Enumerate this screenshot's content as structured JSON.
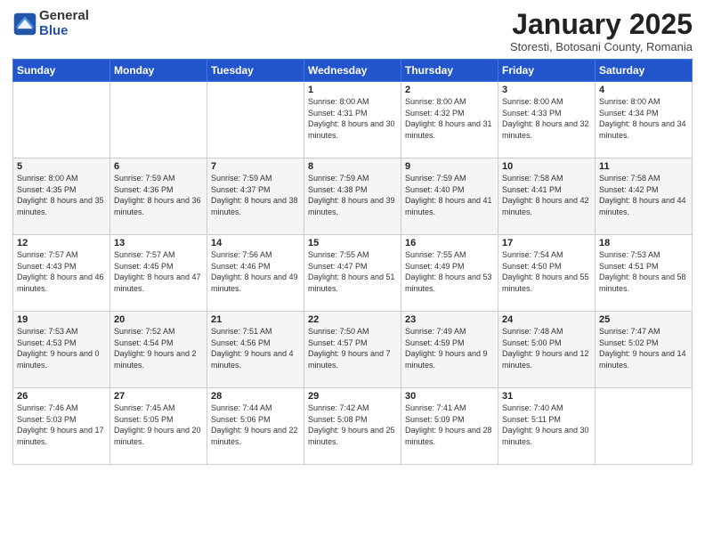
{
  "logo": {
    "general": "General",
    "blue": "Blue"
  },
  "header": {
    "month": "January 2025",
    "location": "Storesti, Botosani County, Romania"
  },
  "weekdays": [
    "Sunday",
    "Monday",
    "Tuesday",
    "Wednesday",
    "Thursday",
    "Friday",
    "Saturday"
  ],
  "weeks": [
    [
      {
        "day": "",
        "info": ""
      },
      {
        "day": "",
        "info": ""
      },
      {
        "day": "",
        "info": ""
      },
      {
        "day": "1",
        "info": "Sunrise: 8:00 AM\nSunset: 4:31 PM\nDaylight: 8 hours\nand 30 minutes."
      },
      {
        "day": "2",
        "info": "Sunrise: 8:00 AM\nSunset: 4:32 PM\nDaylight: 8 hours\nand 31 minutes."
      },
      {
        "day": "3",
        "info": "Sunrise: 8:00 AM\nSunset: 4:33 PM\nDaylight: 8 hours\nand 32 minutes."
      },
      {
        "day": "4",
        "info": "Sunrise: 8:00 AM\nSunset: 4:34 PM\nDaylight: 8 hours\nand 34 minutes."
      }
    ],
    [
      {
        "day": "5",
        "info": "Sunrise: 8:00 AM\nSunset: 4:35 PM\nDaylight: 8 hours\nand 35 minutes."
      },
      {
        "day": "6",
        "info": "Sunrise: 7:59 AM\nSunset: 4:36 PM\nDaylight: 8 hours\nand 36 minutes."
      },
      {
        "day": "7",
        "info": "Sunrise: 7:59 AM\nSunset: 4:37 PM\nDaylight: 8 hours\nand 38 minutes."
      },
      {
        "day": "8",
        "info": "Sunrise: 7:59 AM\nSunset: 4:38 PM\nDaylight: 8 hours\nand 39 minutes."
      },
      {
        "day": "9",
        "info": "Sunrise: 7:59 AM\nSunset: 4:40 PM\nDaylight: 8 hours\nand 41 minutes."
      },
      {
        "day": "10",
        "info": "Sunrise: 7:58 AM\nSunset: 4:41 PM\nDaylight: 8 hours\nand 42 minutes."
      },
      {
        "day": "11",
        "info": "Sunrise: 7:58 AM\nSunset: 4:42 PM\nDaylight: 8 hours\nand 44 minutes."
      }
    ],
    [
      {
        "day": "12",
        "info": "Sunrise: 7:57 AM\nSunset: 4:43 PM\nDaylight: 8 hours\nand 46 minutes."
      },
      {
        "day": "13",
        "info": "Sunrise: 7:57 AM\nSunset: 4:45 PM\nDaylight: 8 hours\nand 47 minutes."
      },
      {
        "day": "14",
        "info": "Sunrise: 7:56 AM\nSunset: 4:46 PM\nDaylight: 8 hours\nand 49 minutes."
      },
      {
        "day": "15",
        "info": "Sunrise: 7:55 AM\nSunset: 4:47 PM\nDaylight: 8 hours\nand 51 minutes."
      },
      {
        "day": "16",
        "info": "Sunrise: 7:55 AM\nSunset: 4:49 PM\nDaylight: 8 hours\nand 53 minutes."
      },
      {
        "day": "17",
        "info": "Sunrise: 7:54 AM\nSunset: 4:50 PM\nDaylight: 8 hours\nand 55 minutes."
      },
      {
        "day": "18",
        "info": "Sunrise: 7:53 AM\nSunset: 4:51 PM\nDaylight: 8 hours\nand 58 minutes."
      }
    ],
    [
      {
        "day": "19",
        "info": "Sunrise: 7:53 AM\nSunset: 4:53 PM\nDaylight: 9 hours\nand 0 minutes."
      },
      {
        "day": "20",
        "info": "Sunrise: 7:52 AM\nSunset: 4:54 PM\nDaylight: 9 hours\nand 2 minutes."
      },
      {
        "day": "21",
        "info": "Sunrise: 7:51 AM\nSunset: 4:56 PM\nDaylight: 9 hours\nand 4 minutes."
      },
      {
        "day": "22",
        "info": "Sunrise: 7:50 AM\nSunset: 4:57 PM\nDaylight: 9 hours\nand 7 minutes."
      },
      {
        "day": "23",
        "info": "Sunrise: 7:49 AM\nSunset: 4:59 PM\nDaylight: 9 hours\nand 9 minutes."
      },
      {
        "day": "24",
        "info": "Sunrise: 7:48 AM\nSunset: 5:00 PM\nDaylight: 9 hours\nand 12 minutes."
      },
      {
        "day": "25",
        "info": "Sunrise: 7:47 AM\nSunset: 5:02 PM\nDaylight: 9 hours\nand 14 minutes."
      }
    ],
    [
      {
        "day": "26",
        "info": "Sunrise: 7:46 AM\nSunset: 5:03 PM\nDaylight: 9 hours\nand 17 minutes."
      },
      {
        "day": "27",
        "info": "Sunrise: 7:45 AM\nSunset: 5:05 PM\nDaylight: 9 hours\nand 20 minutes."
      },
      {
        "day": "28",
        "info": "Sunrise: 7:44 AM\nSunset: 5:06 PM\nDaylight: 9 hours\nand 22 minutes."
      },
      {
        "day": "29",
        "info": "Sunrise: 7:42 AM\nSunset: 5:08 PM\nDaylight: 9 hours\nand 25 minutes."
      },
      {
        "day": "30",
        "info": "Sunrise: 7:41 AM\nSunset: 5:09 PM\nDaylight: 9 hours\nand 28 minutes."
      },
      {
        "day": "31",
        "info": "Sunrise: 7:40 AM\nSunset: 5:11 PM\nDaylight: 9 hours\nand 30 minutes."
      },
      {
        "day": "",
        "info": ""
      }
    ]
  ]
}
